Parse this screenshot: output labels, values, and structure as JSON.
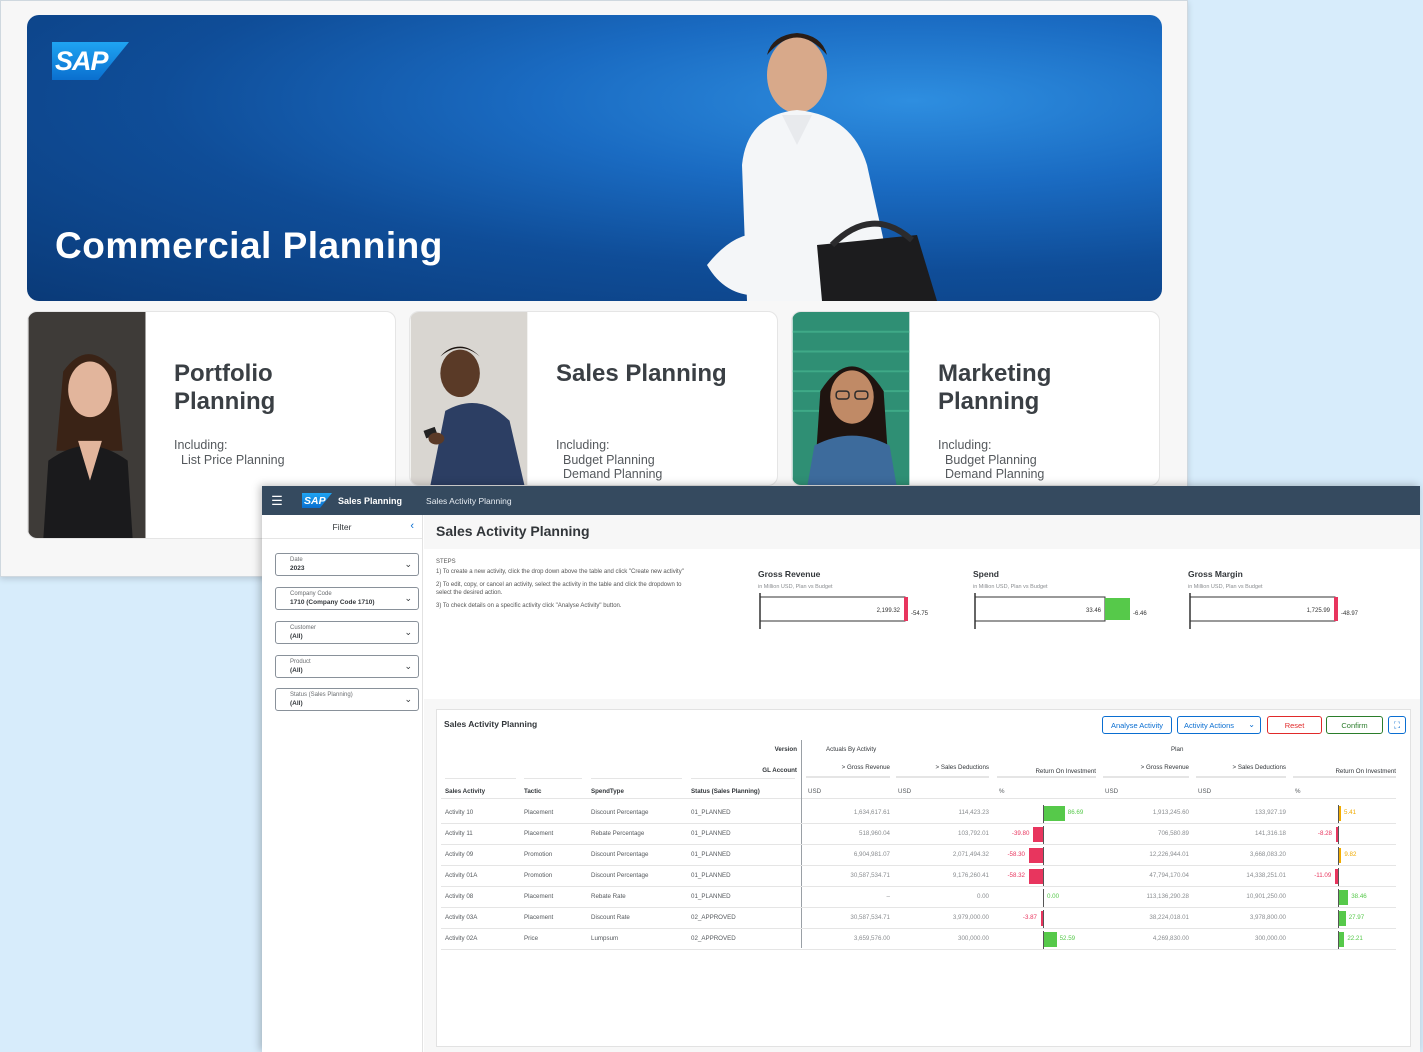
{
  "landing": {
    "logo": "SAP",
    "hero_title": "Commercial Planning",
    "cards": [
      {
        "title_line1": "Portfolio",
        "title_line2": "Planning",
        "including": "Including:",
        "items": [
          "List Price Planning"
        ]
      },
      {
        "title_line1": "Sales Planning",
        "title_line2": "",
        "including": "Including:",
        "items": [
          "Budget Planning",
          "Demand Planning"
        ]
      },
      {
        "title_line1": "Marketing",
        "title_line2": "Planning",
        "including": "Including:",
        "items": [
          "Budget Planning",
          "Demand Planning"
        ]
      }
    ]
  },
  "shell": {
    "logo": "SAP",
    "menu_icon": "hamburger-icon",
    "app_name": "Sales Planning",
    "breadcrumb": "Sales Activity Planning"
  },
  "filter": {
    "title": "Filter",
    "fields": [
      {
        "label": "Date",
        "value": "2023"
      },
      {
        "label": "Company Code",
        "value": "1710 (Company Code 1710)"
      },
      {
        "label": "Customer",
        "value": "(All)"
      },
      {
        "label": "Product",
        "value": "(All)"
      },
      {
        "label": "Status (Sales Planning)",
        "value": "(All)"
      }
    ]
  },
  "page": {
    "title": "Sales Activity Planning",
    "steps_title": "STEPS",
    "steps": [
      "1) To create a new activity, click the drop down above the table and click \"Create new activity\"",
      "2) To edit, copy, or cancel an activity, select the activity in the table and click the dropdown to select the desired action.",
      "3) To check details on a specific activity click \"Analyse Activity\" button."
    ]
  },
  "kpis": [
    {
      "title": "Gross Revenue",
      "subtitle": "in Million USD, Plan vs Budget",
      "plan": "2,199.32",
      "delta": "-54.75",
      "delta_color": "#e8355e"
    },
    {
      "title": "Spend",
      "subtitle": "in Million USD, Plan vs Budget",
      "plan": "33.46",
      "delta": "-6.46",
      "delta_color": "#56c94a"
    },
    {
      "title": "Gross Margin",
      "subtitle": "in Million USD, Plan vs Budget",
      "plan": "1,725.99",
      "delta": "-48.97",
      "delta_color": "#e8355e"
    }
  ],
  "table": {
    "title": "Sales Activity Planning",
    "buttons": {
      "analyse": "Analyse Activity",
      "actions": "Activity Actions",
      "reset": "Reset",
      "confirm": "Confirm"
    },
    "version_label": "Version",
    "gl_label": "GL Account",
    "version_actuals": "Actuals By Activity",
    "version_plan": "Plan",
    "gl_cols": [
      "> Gross Revenue",
      "> Sales Deductions",
      "Return On Investment",
      "> Gross Revenue",
      "> Sales Deductions",
      "Return On Investment"
    ],
    "dim_headers": [
      "Sales Activity",
      "Tactic",
      "SpendType",
      "Status (Sales Planning)"
    ],
    "units": [
      "USD",
      "USD",
      "%",
      "USD",
      "USD",
      "%"
    ],
    "rows": [
      {
        "activity": "Activity 10",
        "tactic": "Placement",
        "spend": "Discount Percentage",
        "status": "01_PLANNED",
        "a_gr": "1,634,617.61",
        "a_sd": "114,423.23",
        "a_roi": "86.69",
        "a_roi_v": 86.69,
        "p_gr": "1,913,245.60",
        "p_sd": "133,927.19",
        "p_roi": "5.41",
        "p_roi_v": 5.41
      },
      {
        "activity": "Activity 11",
        "tactic": "Placement",
        "spend": "Rebate Percentage",
        "status": "01_PLANNED",
        "a_gr": "518,960.04",
        "a_sd": "103,792.01",
        "a_roi": "-39.80",
        "a_roi_v": -39.8,
        "p_gr": "706,580.89",
        "p_sd": "141,316.18",
        "p_roi": "-8.28",
        "p_roi_v": -8.28
      },
      {
        "activity": "Activity 09",
        "tactic": "Promotion",
        "spend": "Discount Percentage",
        "status": "01_PLANNED",
        "a_gr": "6,904,981.07",
        "a_sd": "2,071,494.32",
        "a_roi": "-58.30",
        "a_roi_v": -58.3,
        "p_gr": "12,226,944.01",
        "p_sd": "3,668,083.20",
        "p_roi": "9.82",
        "p_roi_v": 9.82
      },
      {
        "activity": "Activity 01A",
        "tactic": "Promotion",
        "spend": "Discount Percentage",
        "status": "01_PLANNED",
        "a_gr": "30,587,534.71",
        "a_sd": "9,176,260.41",
        "a_roi": "-58.32",
        "a_roi_v": -58.32,
        "p_gr": "47,794,170.04",
        "p_sd": "14,338,251.01",
        "p_roi": "-11.09",
        "p_roi_v": -11.09
      },
      {
        "activity": "Activity 08",
        "tactic": "Placement",
        "spend": "Rebate Rate",
        "status": "01_PLANNED",
        "a_gr": "–",
        "a_sd": "0.00",
        "a_roi": "0.00",
        "a_roi_v": 0,
        "p_gr": "113,136,290.28",
        "p_sd": "10,901,250.00",
        "p_roi": "38.46",
        "p_roi_v": 38.46
      },
      {
        "activity": "Activity 03A",
        "tactic": "Placement",
        "spend": "Discount Rate",
        "status": "02_APPROVED",
        "a_gr": "30,587,534.71",
        "a_sd": "3,979,000.00",
        "a_roi": "-3.87",
        "a_roi_v": -3.87,
        "p_gr": "38,224,018.01",
        "p_sd": "3,978,800.00",
        "p_roi": "27.97",
        "p_roi_v": 27.97
      },
      {
        "activity": "Activity 02A",
        "tactic": "Price",
        "spend": "Lumpsum",
        "status": "02_APPROVED",
        "a_gr": "3,659,576.00",
        "a_sd": "300,000.00",
        "a_roi": "52.59",
        "a_roi_v": 52.59,
        "p_gr": "4,269,830.00",
        "p_sd": "300,000.00",
        "p_roi": "22.21",
        "p_roi_v": 22.21
      }
    ]
  },
  "colors": {
    "positive": "#56c94a",
    "negative": "#e8355e",
    "warning": "#f0ab00",
    "shell": "#354a5f",
    "brand": "#0a6ed1"
  }
}
